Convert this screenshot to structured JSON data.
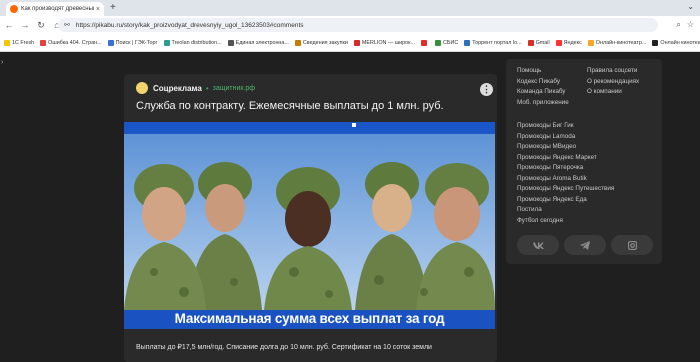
{
  "browser": {
    "tab_title": "Как производят древесный уг...",
    "tab_close": "×",
    "new_tab": "+",
    "url": "https://pikabu.ru/story/kak_proizvodyat_drevesnyiy_ugol_13623503#comments",
    "bookmarks": [
      {
        "label": "1C Fresh",
        "color": "#f5c400"
      },
      {
        "label": "Ошибка 404. Стран...",
        "color": "#e0443c"
      },
      {
        "label": "Поиск | ГЭК-Торг",
        "color": "#3a6fd8"
      },
      {
        "label": "Treolan distribution...",
        "color": "#2a9d8f"
      },
      {
        "label": "Единая электронна...",
        "color": "#555555"
      },
      {
        "label": "Сведения закупки",
        "color": "#c47b00"
      },
      {
        "label": "MERLION — широк...",
        "color": "#d42a2a"
      },
      {
        "label": "",
        "color": "#e52d27"
      },
      {
        "label": "СБИС",
        "color": "#3a8f3a"
      },
      {
        "label": "Торрент портал lo...",
        "color": "#2f6ec1"
      },
      {
        "label": "Gmail",
        "color": "#d93025"
      },
      {
        "label": "Яндекс",
        "color": "#ff3333"
      },
      {
        "label": "Онлайн-кинотеатр...",
        "color": "#f9a825"
      },
      {
        "label": "Онлайн кинотеат",
        "color": "#222222"
      }
    ]
  },
  "post": {
    "brand": "Соцреклама",
    "brand_link": "защитник.рф",
    "menu": "⋮",
    "title": "Служба по контракту. Ежемесячные выплаты до 1 млн. руб.",
    "banner_text": "Максимальная сумма всех выплат за год",
    "description": "Выплаты до ₽17,5 млн/год. Списание долга до 10 млн. руб. Сертификат на 10 соток земли"
  },
  "sidebar": {
    "col1": [
      "Помощь",
      "Кодекс Пикабу",
      "Команда Пикабу",
      "Моб. приложение"
    ],
    "col2": [
      "Правила соцсети",
      "О рекомендациях",
      "О компании"
    ],
    "promos": [
      "Промокоды Биг Гик",
      "Промокоды Lamoda",
      "Промокоды МВидео",
      "Промокоды Яндекс Маркет",
      "Промокоды Пятерочка",
      "Промокоды Aroma Butik",
      "Промокоды Яндекс Путешествия",
      "Промокоды Яндекс Еда",
      "Постила",
      "Футбол сегодня"
    ]
  }
}
